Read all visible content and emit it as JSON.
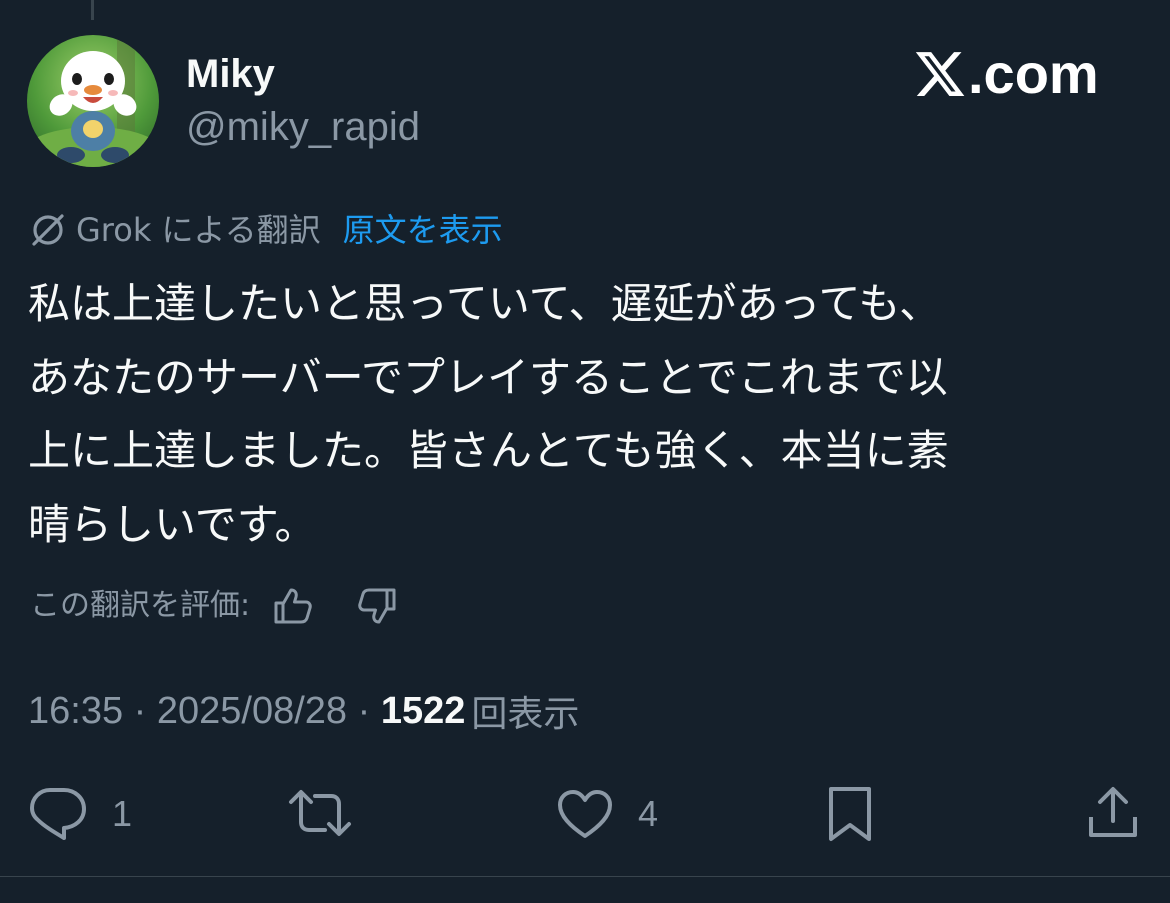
{
  "author": {
    "display_name": "Miky",
    "handle": "@miky_rapid"
  },
  "brand": {
    "text": ".com"
  },
  "translation": {
    "label": "Grok による翻訳",
    "show_original": "原文を表示"
  },
  "tweet": {
    "text": "私は上達したいと思っていて、遅延があっても、\nあなたのサーバーでプレイすることでこれまで以\n上に上達しました。皆さんとても強く、本当に素\n晴らしいです。"
  },
  "rating": {
    "label": "この翻訳を評価:"
  },
  "meta": {
    "time": "16:35",
    "separator": " · ",
    "date": "2025/08/28",
    "views_count": "1522",
    "views_label": "回表示"
  },
  "actions": {
    "reply_count": "1",
    "like_count": "4"
  },
  "icons": [
    "x-logo-icon",
    "grok-icon",
    "thumbs-up-icon",
    "thumbs-down-icon",
    "reply-icon",
    "retweet-icon",
    "heart-icon",
    "bookmark-icon",
    "share-icon"
  ],
  "colors": {
    "background": "#15202b",
    "primary_text": "#f7f9f9",
    "secondary_text": "#8b98a5",
    "link": "#1d9bf0",
    "divider": "#38444d"
  }
}
